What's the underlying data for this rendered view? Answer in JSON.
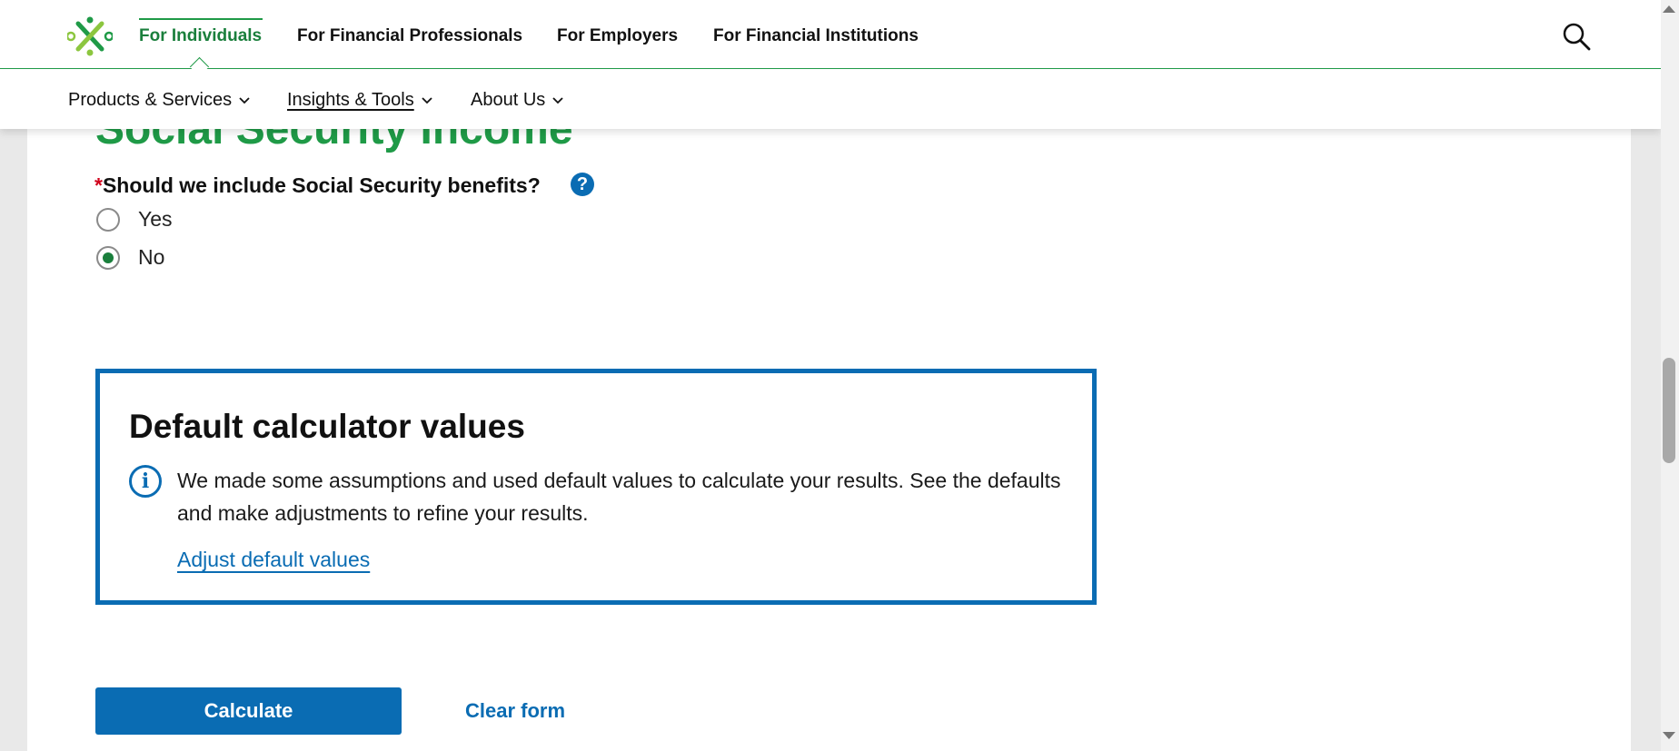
{
  "header": {
    "top_nav": [
      {
        "label": "For Individuals",
        "active": true
      },
      {
        "label": "For Financial Professionals"
      },
      {
        "label": "For Employers"
      },
      {
        "label": "For Financial Institutions"
      }
    ],
    "sub_nav": [
      {
        "label": "Products & Services"
      },
      {
        "label": "Insights & Tools"
      },
      {
        "label": "About Us"
      }
    ]
  },
  "section": {
    "title": "Social Security Income",
    "question_required_mark": "*",
    "question": "Should we include Social Security benefits?",
    "help_icon": "?",
    "options": [
      {
        "label": "Yes",
        "checked": false
      },
      {
        "label": "No",
        "checked": true
      }
    ]
  },
  "defaults_box": {
    "title": "Default calculator values",
    "info_icon": "i",
    "text": "We made some assumptions and used default values to calculate your results. See the defaults and make adjustments to refine your results.",
    "link": "Adjust default values"
  },
  "actions": {
    "calculate": "Calculate",
    "clear": "Clear form"
  },
  "colors": {
    "brand_green": "#1f9a47",
    "accent_blue": "#0a6cb3"
  }
}
